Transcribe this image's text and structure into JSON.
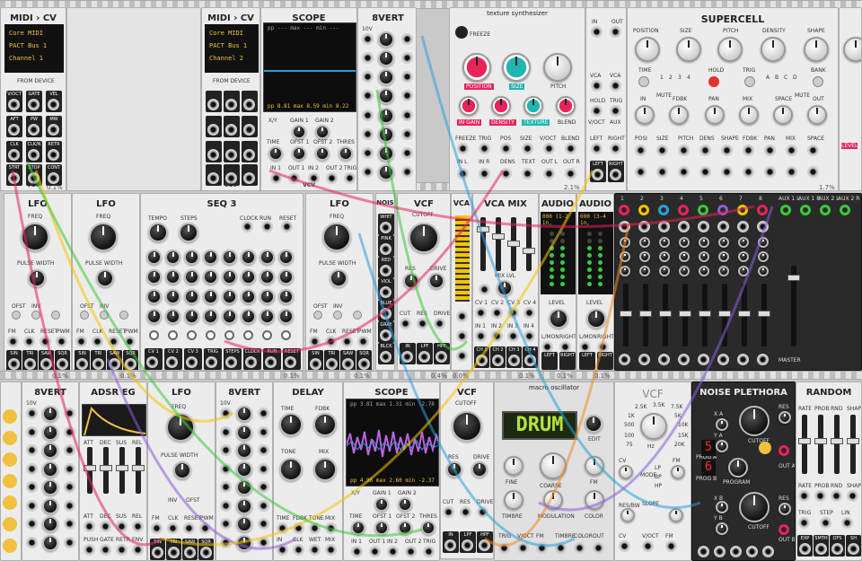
{
  "colors": {
    "rail": "#c9c9c9",
    "panel": "#ececec",
    "dark": "#2a2a2a",
    "accent_pink": "#e8235a",
    "accent_teal": "#1fb5b0",
    "accent_yellow": "#f0c040",
    "lcd": "#b6e33c"
  },
  "row1": {
    "midi1": {
      "title": "MIDI › CV",
      "lines": [
        "Core MIDI",
        "PACT Bus 1",
        "Channel 1"
      ],
      "from": "FROM DEVICE",
      "jacks": [
        "V/OCT",
        "GATE",
        "VEL",
        "AFT",
        "PW",
        "MW",
        "CLK",
        "CLK/N",
        "RETR",
        "STRT",
        "STOP",
        "CONT"
      ],
      "brand": "VCV",
      "cpu": "0.1%"
    },
    "midi2": {
      "title": "MIDI › CV",
      "lines": [
        "Core MIDI",
        "PACT Bus 1",
        "Channel 2"
      ],
      "from": "FROM DEVICE",
      "brand": "VCV",
      "cpu": "0.1%"
    },
    "scope1": {
      "title": "SCOPE",
      "readout_top": "pp  ---  max  ---  min  ---",
      "readout_bot": "pp  8.81  max  8.59  min  8.22",
      "labels": [
        "X/Y",
        "GAIN 1",
        "GAIN 2",
        "TIME",
        "OFST 1",
        "OFST 2",
        "THRES",
        "IN 1",
        "OUT 1",
        "IN 2",
        "OUT 2",
        "TRIG"
      ],
      "brand": "VCV",
      "cpu": "0.0%"
    },
    "eightvert1": {
      "title": "8VERT",
      "top": "10V",
      "cpu": "0.1%"
    },
    "texture": {
      "title": "texture synthesizer",
      "freeze": "FREEZE",
      "knobs": [
        "POSITION",
        "SIZE",
        "PITCH",
        "IN GAIN",
        "DENSITY",
        "TEXTURE",
        "BLEND"
      ],
      "jacks": [
        "FREEZE",
        "TRIG",
        "POS",
        "SIZE",
        "PITCH",
        "BLEND",
        "IN L",
        "IN R",
        "DENS",
        "TEXT",
        "OUT L",
        "OUT R",
        "V/OCT"
      ],
      "cpu": "2.1%"
    },
    "strip": {
      "labels": [
        "IN",
        "OUT",
        "VCA",
        "VCA",
        "HOLD",
        "TRIG",
        "V/OCT",
        "AUX",
        "LEFT",
        "RIGHT",
        "LEFT",
        "RIGHT"
      ]
    },
    "supercell": {
      "title": "SUPERCELL",
      "knobs": [
        "POSITION",
        "SIZE",
        "PITCH",
        "DENSITY",
        "SHAPE",
        "IN",
        "FDBK",
        "PAN",
        "MIX",
        "SPACE",
        "OUT"
      ],
      "buttons": [
        "TIME",
        "HOLD",
        "TRIG",
        "BANK",
        "MUTE",
        "MUTE"
      ],
      "modes": [
        "1",
        "2",
        "3",
        "4",
        "A",
        "B",
        "C",
        "D"
      ],
      "jacks": [
        "POSI",
        "SIZE",
        "PITCH",
        "DENS",
        "SHAPE",
        "FDBK",
        "PAN",
        "MIX",
        "SPACE"
      ],
      "cpu": "1.7%"
    }
  },
  "row2": {
    "lfo1": {
      "title": "LFO",
      "freq": "FREQ",
      "pw": "PULSE WIDTH",
      "labels": [
        "OFST",
        "INV",
        "FM",
        "CLK",
        "RESET",
        "PWM",
        "SIN",
        "TRI",
        "SAW",
        "SQR"
      ],
      "cpu": "0.1%"
    },
    "lfo2": {
      "title": "LFO",
      "cpu": "0.1%"
    },
    "seq3": {
      "title": "SEQ 3",
      "labels": [
        "TEMPO",
        "STEPS",
        "CLOCK",
        "RUN",
        "RESET",
        "TEMPO",
        "STEPS",
        "CLK",
        "RUN",
        "RESET",
        "CV 1",
        "CV 2",
        "CV 3",
        "TRIG",
        "STEPS",
        "CLOCK",
        "RUN",
        "RESET"
      ],
      "cpu": "0.1%"
    },
    "lfo3": {
      "title": "LFO",
      "cpu": "0.1%"
    },
    "nois": {
      "title": "NOIS",
      "colors": [
        "WHIT",
        "PINK",
        "RED",
        "VIOL",
        "BLUE",
        "GRAY",
        "BLCK"
      ],
      "cpu": "0.1%"
    },
    "vcf1": {
      "title": "VCF",
      "knobs": [
        "CUTOFF",
        "FREQ",
        "RES",
        "DRIVE"
      ],
      "jacks": [
        "CUT",
        "RES",
        "DRIVE",
        "IN",
        "LPF",
        "HPF"
      ],
      "cpu": "0.4%"
    },
    "vca": {
      "title": "VCA",
      "cpu": "0.0%"
    },
    "vcamix": {
      "title": "VCA MIX",
      "knob": "MIX LVL",
      "jacks": [
        "CV 1",
        "CV 2",
        "CV 3",
        "CV 4",
        "IN 1",
        "IN 2",
        "IN 3",
        "IN 4",
        "CH 1",
        "CH 2",
        "CH 3",
        "CH 4",
        "MIX"
      ],
      "cpu": "0.1%"
    },
    "audio1": {
      "title": "AUDIO",
      "device": "000 (1-2 in,",
      "level": "LEVEL",
      "jacks": [
        "L/MON",
        "RIGHT",
        "LEFT",
        "RIGHT"
      ],
      "cpu": "0.1%"
    },
    "audio2": {
      "title": "AUDIO",
      "device": "000 (3-4 in,",
      "level": "LEVEL",
      "cpu": "0.1%"
    },
    "mixer": {
      "channels": [
        "1",
        "2",
        "3",
        "4",
        "5",
        "6",
        "7",
        "8"
      ],
      "aux": [
        "AUX 1 L",
        "AUX 1 R",
        "AUX 2 L",
        "AUX 2 R"
      ],
      "master": "MASTER"
    }
  },
  "row3": {
    "eightvert2": {
      "title": "8VERT",
      "top": "10V"
    },
    "adsr": {
      "title": "ADSR EG",
      "knobs": [
        "ATT",
        "DEC",
        "SUS",
        "REL"
      ],
      "jacks": [
        "PUSH",
        "GATE",
        "RETR",
        "ENV"
      ]
    },
    "lfo4": {
      "title": "LFO",
      "freq": "FREQ",
      "pw": "PULSE WIDTH",
      "labels": [
        "INV",
        "OFST",
        "FM",
        "CLK",
        "RESET",
        "PWM",
        "SIN",
        "TRI",
        "SAW",
        "SQR"
      ]
    },
    "eightvert3": {
      "title": "8VERT",
      "top": "10V"
    },
    "delay": {
      "title": "DELAY",
      "knobs": [
        "TIME",
        "FDBK",
        "TONE",
        "MIX"
      ],
      "jacks": [
        "TIME",
        "FDBK",
        "TONE",
        "MIX",
        "IN",
        "CLK",
        "WET",
        "MIX"
      ]
    },
    "scope2": {
      "title": "SCOPE",
      "readout_top": "pp  3.81  max  1.31  min  -2.78",
      "readout_bot": "pp  4.96  max  2.60  min  -2.37",
      "labels": [
        "X/Y",
        "GAIN 1",
        "GAIN 2",
        "TIME",
        "OFST 1",
        "OFST 2",
        "THRES",
        "IN 1",
        "OUT 1",
        "IN 2",
        "OUT 2",
        "TRIG"
      ]
    },
    "vcf2": {
      "title": "VCF",
      "knobs": [
        "CUTOFF",
        "FREQ",
        "RES",
        "DRIVE"
      ],
      "jacks": [
        "CUT",
        "RES",
        "DRIVE",
        "IN",
        "LPF",
        "HPF"
      ]
    },
    "macro": {
      "title": "macro oscillator",
      "display": "DRUM",
      "knobs": [
        "EDIT",
        "FINE",
        "COARSE",
        "FM",
        "TIMBRE",
        "MODULATION",
        "COLOR"
      ],
      "jacks": [
        "TRIG",
        "V/OCT",
        "FM",
        "TIMBRE",
        "COLOR",
        "OUT"
      ]
    },
    "vcf3": {
      "title": "VCF",
      "freq": [
        "2.5K",
        "3.5K",
        "7.5K",
        "1K",
        "500",
        "100",
        "75",
        "5K",
        "10K",
        "15K",
        "20K"
      ],
      "labels": [
        "Hz",
        "CV",
        "FM",
        "MODE",
        "LP",
        "BP",
        "HP",
        "SLOPE",
        "RES/BW",
        "CV",
        "V/OCT",
        "FM",
        "IN",
        "N/BW",
        "OUT"
      ]
    },
    "noise": {
      "title": "NOISE PLETHORA",
      "prog": [
        "PROG A",
        "PROG B"
      ],
      "digits": [
        "5",
        "6"
      ],
      "labels": [
        "X A",
        "Y A",
        "CUTOFF",
        "RES",
        "X B",
        "Y B",
        "CUTOFF",
        "RES",
        "PROGRAM",
        "OUT A",
        "OUT B"
      ]
    },
    "random": {
      "title": "RANDOM",
      "knobs": [
        "RATE",
        "PROB",
        "RND",
        "SHAPE"
      ],
      "jacks": [
        "TRIG",
        "STEP",
        "LIN",
        "EXP",
        "SMTH",
        "OFS",
        "SH"
      ]
    }
  }
}
